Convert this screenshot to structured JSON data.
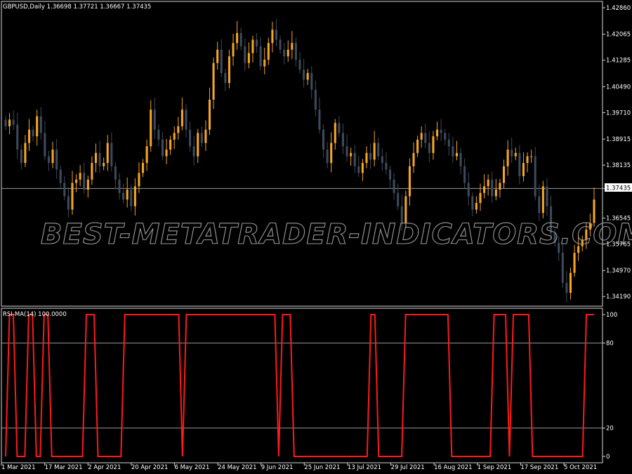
{
  "header": {
    "symbol_info": "GBPUSD,Daily  1.36698 1.37721 1.36667 1.37435"
  },
  "indicator": {
    "label": "RSI-MA(14) 100.0000",
    "levels": [
      100,
      80,
      20,
      0
    ],
    "level_lines": [
      80,
      20
    ],
    "line_color": "#ff1a1a"
  },
  "watermark": "BEST-METATRADER-INDICATORS.COM",
  "current_price": "1.37435",
  "colors": {
    "background": "#000000",
    "bull": "#f5a623",
    "bear": "#3d4a5c",
    "grid_line": "#c8c8c8",
    "rsi_line": "#ff1a1a"
  },
  "chart_data": [
    {
      "type": "candlestick",
      "price_axis_labels": [
        "1.42860",
        "1.42065",
        "1.41285",
        "1.40490",
        "1.39710",
        "1.38915",
        "1.38135",
        "1.37435",
        "1.36545",
        "1.35765",
        "1.34970",
        "1.34190"
      ],
      "price_axis_values": [
        1.4286,
        1.42065,
        1.41285,
        1.4049,
        1.3971,
        1.38915,
        1.38135,
        1.37435,
        1.36545,
        1.35765,
        1.3497,
        1.3419
      ],
      "ylim": [
        1.339,
        1.4305
      ],
      "x_axis_labels": [
        "1 Mar 2021",
        "17 Mar 2021",
        "2 Apr 2021",
        "20 Apr 2021",
        "6 May 2021",
        "24 May 2021",
        "9 Jun 2021",
        "25 Jun 2021",
        "13 Jul 2021",
        "29 Jul 2021",
        "16 Aug 2021",
        "1 Sep 2021",
        "17 Sep 2021",
        "5 Oct 2021"
      ],
      "close_series": [
        1.393,
        1.395,
        1.3935,
        1.386,
        1.382,
        1.388,
        1.392,
        1.39,
        1.396,
        1.391,
        1.384,
        1.382,
        1.386,
        1.38,
        1.376,
        1.372,
        1.368,
        1.376,
        1.377,
        1.379,
        1.374,
        1.377,
        1.382,
        1.385,
        1.381,
        1.382,
        1.388,
        1.381,
        1.377,
        1.373,
        1.371,
        1.374,
        1.369,
        1.375,
        1.379,
        1.382,
        1.387,
        1.398,
        1.392,
        1.389,
        1.384,
        1.386,
        1.389,
        1.391,
        1.393,
        1.398,
        1.392,
        1.387,
        1.384,
        1.391,
        1.388,
        1.392,
        1.401,
        1.412,
        1.416,
        1.409,
        1.406,
        1.414,
        1.418,
        1.421,
        1.417,
        1.412,
        1.415,
        1.419,
        1.417,
        1.411,
        1.413,
        1.418,
        1.422,
        1.419,
        1.416,
        1.414,
        1.416,
        1.418,
        1.413,
        1.41,
        1.407,
        1.409,
        1.404,
        1.398,
        1.392,
        1.386,
        1.382,
        1.388,
        1.394,
        1.391,
        1.387,
        1.384,
        1.385,
        1.381,
        1.379,
        1.382,
        1.385,
        1.383,
        1.388,
        1.384,
        1.382,
        1.38,
        1.377,
        1.373,
        1.369,
        1.364,
        1.372,
        1.381,
        1.385,
        1.389,
        1.391,
        1.388,
        1.385,
        1.39,
        1.392,
        1.391,
        1.389,
        1.387,
        1.384,
        1.385,
        1.381,
        1.376,
        1.372,
        1.368,
        1.37,
        1.373,
        1.375,
        1.377,
        1.372,
        1.374,
        1.376,
        1.381,
        1.386,
        1.384,
        1.385,
        1.378,
        1.382,
        1.384,
        1.384,
        1.372,
        1.367,
        1.375,
        1.369,
        1.361,
        1.358,
        1.355,
        1.346,
        1.343,
        1.349,
        1.355,
        1.357,
        1.359,
        1.362,
        1.364,
        1.371
      ],
      "rsi_values": [
        0,
        100,
        100,
        0,
        0,
        0,
        100,
        100,
        0,
        0,
        100,
        100,
        0,
        0,
        0,
        0,
        0,
        0,
        0,
        0,
        0,
        100,
        100,
        100,
        0,
        0,
        0,
        0,
        0,
        0,
        0,
        100,
        100,
        100,
        100,
        100,
        100,
        100,
        100,
        100,
        100,
        100,
        100,
        100,
        100,
        100,
        0,
        100,
        100,
        100,
        100,
        100,
        100,
        100,
        100,
        100,
        100,
        100,
        100,
        100,
        100,
        100,
        100,
        100,
        100,
        100,
        100,
        100,
        100,
        100,
        100,
        0,
        100,
        100,
        100,
        0,
        0,
        0,
        0,
        0,
        0,
        0,
        0,
        0,
        0,
        0,
        0,
        0,
        0,
        0,
        0,
        0,
        0,
        0,
        0,
        100,
        100,
        0,
        0,
        0,
        0,
        0,
        0,
        0,
        100,
        100,
        100,
        100,
        100,
        100,
        100,
        100,
        100,
        100,
        100,
        100,
        0,
        0,
        0,
        0,
        0,
        0,
        0,
        0,
        0,
        0,
        0,
        100,
        100,
        100,
        100,
        0,
        100,
        100,
        100,
        100,
        100,
        0,
        0,
        0,
        0,
        0,
        0,
        0,
        0,
        0,
        0,
        0,
        0,
        0,
        0,
        100,
        100,
        100
      ]
    }
  ]
}
